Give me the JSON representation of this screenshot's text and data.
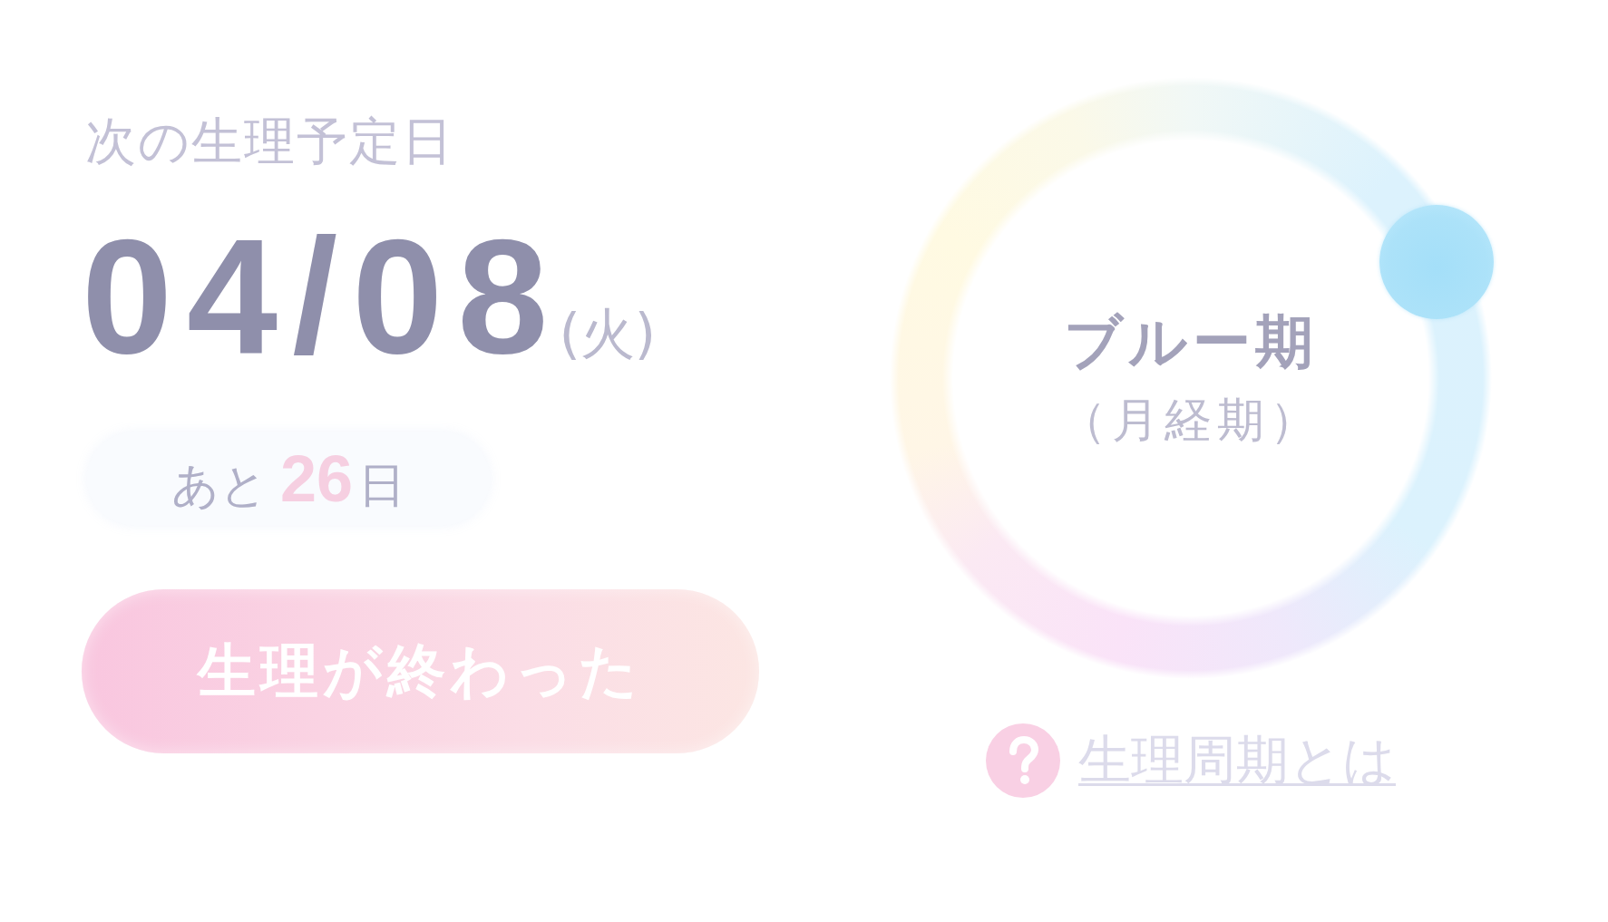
{
  "next_period": {
    "label": "次の生理予定日",
    "date": "04/08",
    "weekday": "(火)"
  },
  "countdown": {
    "prefix": "あと",
    "days": "26",
    "suffix": "日"
  },
  "end_period_button": {
    "label": "生理が終わった"
  },
  "cycle_ring": {
    "level": 0.18,
    "phase": "ブルー期",
    "phase_note": "（月経期）"
  },
  "help_link": {
    "label": "生理周期とは"
  }
}
